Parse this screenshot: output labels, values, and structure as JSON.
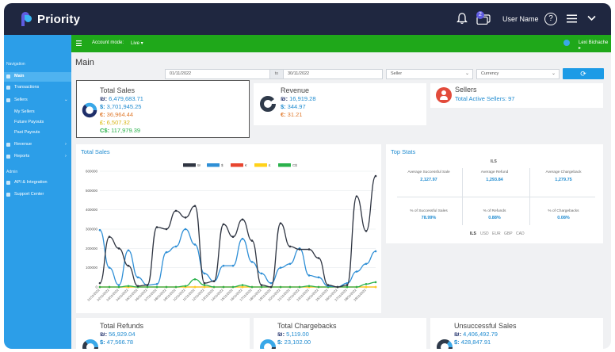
{
  "app": {
    "name": "Priority"
  },
  "topbar": {
    "notification_count": "2",
    "username": "User Name",
    "help": "?"
  },
  "greenbar": {
    "account_mode_label": "Account mode:",
    "account_mode_value": "Live",
    "user": "Lexi Bichache"
  },
  "sidebar": {
    "section_navigation": "Navigation",
    "items": [
      {
        "label": "Main"
      },
      {
        "label": "Transactions"
      },
      {
        "label": "Sellers"
      },
      {
        "label": "My Sellers"
      },
      {
        "label": "Future Payouts"
      },
      {
        "label": "Past Payouts"
      },
      {
        "label": "Revenue"
      },
      {
        "label": "Reports"
      }
    ],
    "section_admin": "Admin",
    "admin_items": [
      {
        "label": "API & Integration"
      },
      {
        "label": "Support Center"
      }
    ]
  },
  "main": {
    "title": "Main",
    "filters": {
      "date_from": "01/11/2022",
      "to_label": "to",
      "date_to": "30/11/2022",
      "seller": "Seller",
      "currency": "Currency"
    }
  },
  "total_sales": {
    "title": "Total Sales",
    "rows": [
      {
        "sym": "₪:",
        "value": "6,479,683.71"
      },
      {
        "sym": "$:",
        "value": "3,701,945.25"
      },
      {
        "sym": "€:",
        "value": "36,964.44"
      },
      {
        "sym": "£:",
        "value": "6,507.32"
      },
      {
        "sym": "C$:",
        "value": "117,979.39"
      }
    ]
  },
  "revenue": {
    "title": "Revenue",
    "rows": [
      {
        "sym": "₪:",
        "value": "16,919.28"
      },
      {
        "sym": "$:",
        "value": "344.97"
      },
      {
        "sym": "€:",
        "value": "31.21"
      }
    ]
  },
  "sellers": {
    "title": "Sellers",
    "active": "Total Active Sellers: 97"
  },
  "total_sales_chart": {
    "title": "Total Sales",
    "legend": [
      "₪",
      "$",
      "€",
      "£",
      "C$"
    ]
  },
  "chart_data": {
    "type": "line",
    "title": "Total Sales",
    "x": [
      "01/11/2022",
      "02/11/2022",
      "03/11/2022",
      "04/11/2022",
      "05/11/2022",
      "06/11/2022",
      "07/11/2022",
      "08/11/2022",
      "09/11/2022",
      "10/11/2022",
      "11/11/2022",
      "12/11/2022",
      "13/11/2022",
      "14/11/2022",
      "15/11/2022",
      "16/11/2022",
      "17/11/2022",
      "18/11/2022",
      "19/11/2022",
      "20/11/2022",
      "21/11/2022",
      "22/11/2022",
      "23/11/2022",
      "24/11/2022",
      "25/11/2022",
      "26/11/2022",
      "27/11/2022",
      "28/11/2022",
      "29/11/2022",
      "30/11/2022"
    ],
    "xtick_labels": [
      "01/11/2022",
      "02/11/2022",
      "03/11/2022",
      "04/11/2022",
      "05/11/2022",
      "06/11/2022",
      "07/11/2022",
      "08/11/2022",
      "09/11/2022",
      "10/11/2022",
      "11/11/2022",
      "12/11/2022",
      "13/11/2022",
      "14/11/2022",
      "15/11/2022",
      "16/11/2022",
      "17/11/2022",
      "18/11/2022",
      "19/11/2022",
      "20/11/2022",
      "21/11/2022",
      "22/11/2022",
      "23/11/2022",
      "24/11/2022",
      "25/11/2022",
      "26/11/2022",
      "27/11/2022",
      "28/11/2022",
      "29/11/2022"
    ],
    "ylim": [
      0,
      600000
    ],
    "yticks": [
      0,
      100000,
      200000,
      300000,
      400000,
      500000,
      600000
    ],
    "series": [
      {
        "name": "₪",
        "color": "#2f3542",
        "values": [
          20000,
          260000,
          200000,
          110000,
          5000,
          10000,
          310000,
          300000,
          395000,
          360000,
          420000,
          20000,
          30000,
          325000,
          260000,
          350000,
          240000,
          10000,
          0,
          330000,
          210000,
          195000,
          195000,
          150000,
          10000,
          0,
          10000,
          470000,
          290000,
          575000
        ]
      },
      {
        "name": "$",
        "color": "#2f8fd6",
        "values": [
          295000,
          100000,
          10000,
          190000,
          50000,
          10000,
          15000,
          180000,
          210000,
          300000,
          220000,
          70000,
          30000,
          110000,
          110000,
          250000,
          130000,
          70000,
          20000,
          100000,
          120000,
          200000,
          60000,
          50000,
          5000,
          0,
          20000,
          80000,
          120000,
          185000
        ]
      },
      {
        "name": "€",
        "color": "#e8452f",
        "values": [
          0,
          0,
          0,
          0,
          0,
          0,
          0,
          0,
          0,
          0,
          0,
          0,
          0,
          0,
          0,
          0,
          0,
          0,
          0,
          0,
          0,
          0,
          0,
          0,
          0,
          0,
          0,
          0,
          0,
          0
        ]
      },
      {
        "name": "£",
        "color": "#ffd21a",
        "values": [
          0,
          0,
          0,
          0,
          0,
          0,
          0,
          0,
          0,
          0,
          0,
          0,
          0,
          0,
          0,
          0,
          0,
          0,
          0,
          0,
          0,
          0,
          0,
          0,
          0,
          0,
          0,
          0,
          0,
          0
        ]
      },
      {
        "name": "C$",
        "color": "#2bb24c",
        "values": [
          0,
          0,
          0,
          5000,
          0,
          0,
          0,
          0,
          0,
          5000,
          40000,
          10000,
          0,
          0,
          0,
          10000,
          0,
          0,
          0,
          0,
          0,
          0,
          5000,
          0,
          0,
          0,
          0,
          0,
          15000,
          25000
        ]
      }
    ],
    "legend_position": "top-center",
    "grid": true
  },
  "top_stats": {
    "title": "Top Stats",
    "currency": "ILS",
    "cells": [
      {
        "label": "Average Successful Sale",
        "value": "2,127.97"
      },
      {
        "label": "Average Refund",
        "value": "1,293.84"
      },
      {
        "label": "Average Chargeback",
        "value": "1,279.75"
      },
      {
        "label": "% of Successful Sales",
        "value": "78.99%"
      },
      {
        "label": "% of Refunds",
        "value": "0.88%"
      },
      {
        "label": "% of Chargebacks",
        "value": "0.08%"
      }
    ],
    "tabs": [
      "ILS",
      "USD",
      "EUR",
      "GBP",
      "CAD"
    ]
  },
  "total_refunds": {
    "title": "Total Refunds",
    "rows": [
      {
        "sym": "₪:",
        "value": "56,929.04"
      },
      {
        "sym": "$:",
        "value": "47,566.78"
      }
    ]
  },
  "total_chargebacks": {
    "title": "Total Chargebacks",
    "rows": [
      {
        "sym": "₪:",
        "value": "5,119.00"
      },
      {
        "sym": "$:",
        "value": "23,102.00"
      }
    ]
  },
  "unsuccessful_sales": {
    "title": "Unsuccessful Sales",
    "rows": [
      {
        "sym": "₪:",
        "value": "4,406,492.79"
      },
      {
        "sym": "$:",
        "value": "428,847.91"
      }
    ]
  },
  "colors": {
    "topbar": "#1f2740",
    "sidebar": "#2c9ee8",
    "green": "#1fa81a",
    "accent": "#1f8bd0"
  }
}
